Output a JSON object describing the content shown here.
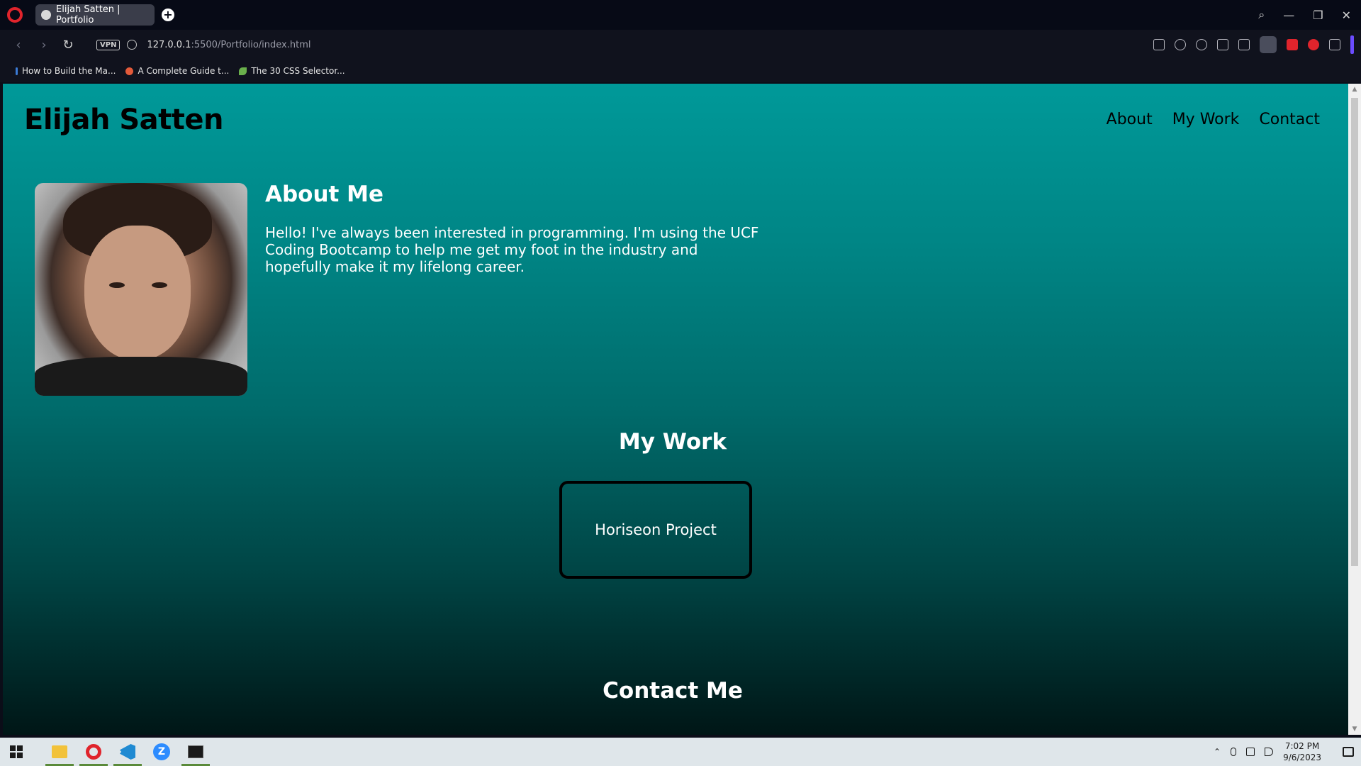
{
  "browser": {
    "tab_title": "Elijah Satten | Portfolio",
    "url_host": "127.0.0.1",
    "url_path": ":5500/Portfolio/index.html",
    "vpn_label": "VPN",
    "bookmarks": [
      "How to Build the Ma...",
      "A Complete Guide t...",
      "The 30 CSS Selector..."
    ]
  },
  "site": {
    "title": "Elijah Satten",
    "nav": [
      "About",
      "My Work",
      "Contact"
    ],
    "about": {
      "heading": "About Me",
      "text": "Hello! I've always been interested in programming. I'm using the UCF Coding Bootcamp to help me get my foot in the industry and hopefully make it my lifelong career."
    },
    "work": {
      "heading": "My Work",
      "projects": [
        "Horiseon Project"
      ]
    },
    "contact": {
      "heading": "Contact Me"
    }
  },
  "taskbar": {
    "time": "7:02 PM",
    "date": "9/6/2023"
  },
  "colors": {
    "gradient_top": "#009999",
    "gradient_bottom": "#001616",
    "accent_red": "#e0242c"
  }
}
